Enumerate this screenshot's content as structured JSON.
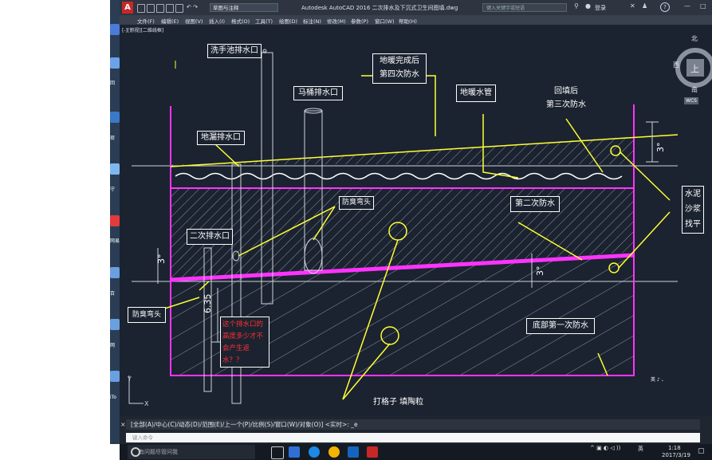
{
  "app": {
    "logo_letter": "A",
    "workspace": "草图与注释",
    "title": "Autodesk AutoCAD 2016    二次排水及下沉式卫生间图填.dwg",
    "search_placeholder": "键入关键字或短语",
    "sign_in": "登录",
    "help": "?"
  },
  "menu": [
    "文件(F)",
    "编辑(E)",
    "视图(V)",
    "插入(I)",
    "格式(O)",
    "工具(T)",
    "绘图(D)",
    "标注(N)",
    "修改(M)",
    "参数(P)",
    "窗口(W)",
    "帮助(H)"
  ],
  "viewport_label": "[-][俯视][二维线框]",
  "viewcube": {
    "north": "北",
    "west": "西",
    "top": "上",
    "south": "南",
    "wcs": "WCS"
  },
  "labels": {
    "basin_drain": "洗手池排水口",
    "floor_heating_done": "地暖完成后",
    "fourth_waterproof": "第四次防水",
    "toilet_drain": "马桶排水口",
    "floor_heating_pipe": "地暖水管",
    "backfill": "回填后",
    "third_waterproof": "第三次防水",
    "floor_drain": "地漏排水口",
    "odor_bend_mid": "防臭弯头",
    "second_waterproof": "第二次防水",
    "secondary_drain": "二次排水口",
    "odor_bend_left": "防臭弯头",
    "question": "这个排水口的高度多少才不会产生返水？？",
    "bottom_first_waterproof": "底部第一次防水",
    "tile_text": "打格子 填陶粒",
    "cement_mortar": "水泥沙浆找平",
    "dimension": "6.35",
    "slope_top": "3°",
    "slope_left": "3°",
    "slope_mid": "3°",
    "ucs_y": "Y",
    "ucs_x": "X"
  },
  "command": {
    "line": "[全部(A)/中心(C)/动态(D)/范围(E)/上一个(P)/比例(S)/窗口(W)/对象(O)] <实时>: _e",
    "placeholder": "键入命令"
  },
  "status_mini": "英 ♪ 、",
  "desktop_labels": [
    "回",
    "回",
    "荷",
    "守",
    "网易",
    "写",
    "百",
    "网",
    "iTo"
  ],
  "taskbar": {
    "search_placeholder": "有问题尽管问我",
    "tray_text": "英",
    "time": "1:18",
    "date": "2017/3/19"
  },
  "colors": {
    "drawing_bg": "#1b2330",
    "magenta": "#ff33ff",
    "yellow": "#ffff33",
    "white": "#ffffff",
    "red_text": "#ff3030"
  }
}
